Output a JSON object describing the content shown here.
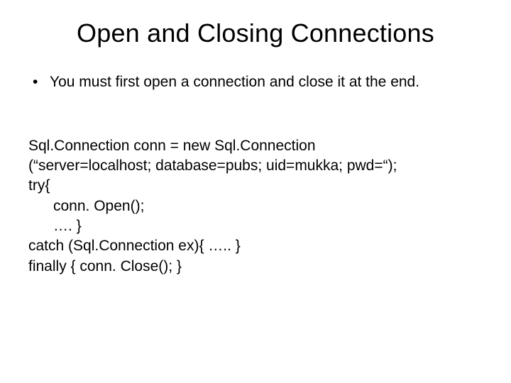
{
  "title": "Open and Closing Connections",
  "bullet": {
    "dot": "•",
    "text": "You must first open a connection and close it at the end."
  },
  "code": {
    "l1": "Sql.Connection conn = new Sql.Connection",
    "l2": "(“server=localhost; database=pubs; uid=mukka; pwd=“);",
    "l3": "try{",
    "l4": "      conn. Open();",
    "l5": "      …. }",
    "l6": "catch (Sql.Connection ex){ ….. }",
    "l7": "finally { conn. Close(); }"
  }
}
